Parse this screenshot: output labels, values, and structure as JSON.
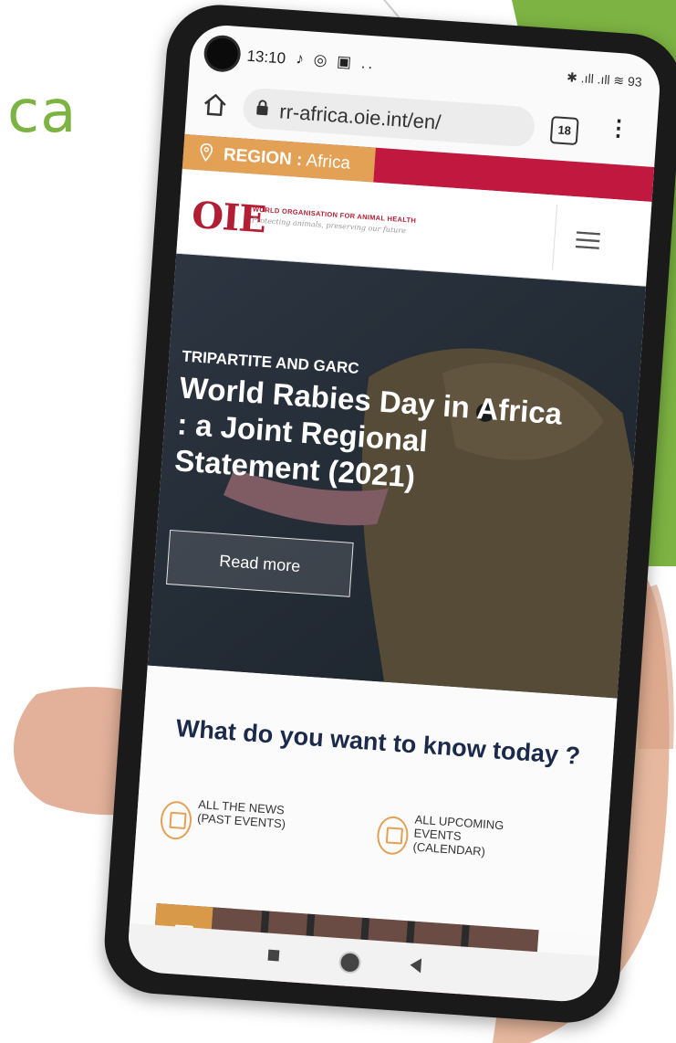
{
  "slide": {
    "title_fragment": "ca",
    "accent_color": "#7cb342"
  },
  "status_bar": {
    "time": "13:10",
    "notifications": "♪ ◎ ▣ ..",
    "right": "✱ .ıll .ıll ≋ 93"
  },
  "browser": {
    "url": "rr-africa.oie.int/en/",
    "tab_count": "18",
    "menu_icon": "more-vert-icon"
  },
  "region_bar": {
    "label": "REGION :",
    "value": "Africa",
    "left_color": "#e2a155",
    "right_color": "#c0183e"
  },
  "site_header": {
    "logo_mark": "OIE",
    "org_name": "WORLD ORGANISATION FOR ANIMAL HEALTH",
    "tagline": "Protecting animals, preserving our future"
  },
  "hero": {
    "kicker": "TRIPARTITE AND GARC",
    "title": "World Rabies Day in Africa : a Joint Regional Statement (2021)",
    "button_label": "Read more"
  },
  "know": {
    "title": "What do you want to know today ?",
    "links": [
      {
        "label": "ALL THE NEWS (PAST EVENTS)",
        "icon": "newspaper-icon"
      },
      {
        "label": "ALL UPCOMING EVENTS (CALENDAR)",
        "icon": "calendar-icon"
      }
    ]
  },
  "nav_bar": {
    "buttons": [
      "recent-apps",
      "home",
      "back"
    ]
  }
}
